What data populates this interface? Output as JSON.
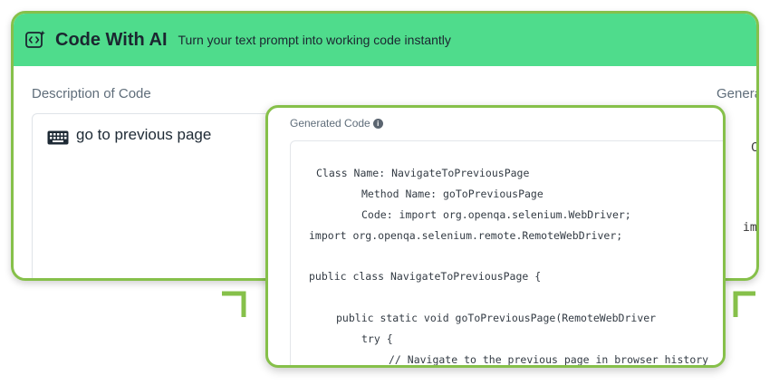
{
  "header": {
    "logo_icon": "code-sparkle-icon",
    "title": "Code With AI",
    "subtitle": "Turn your text prompt into working code instantly"
  },
  "description": {
    "label": "Description of Code",
    "input_icon": "keyboard-icon",
    "input_value": "go to previous page"
  },
  "generated_right": {
    "label_partial": "Genera",
    "frag_1": "C",
    "frag_2": "im"
  },
  "overlay": {
    "label": "Generated Code",
    "info_icon": "info-icon",
    "code_lines": [
      "Class Name: NavigateToPreviousPage",
      "Method Name: goToPreviousPage",
      "Code: import org.openqa.selenium.WebDriver;",
      "import org.openqa.selenium.remote.RemoteWebDriver;",
      "public class NavigateToPreviousPage {",
      "public static void goToPreviousPage(RemoteWebDriver",
      "try {",
      "// Navigate to the previous page in browser history"
    ]
  },
  "colors": {
    "header_bg": "#4fdc8c",
    "card_border": "#86c04a"
  }
}
